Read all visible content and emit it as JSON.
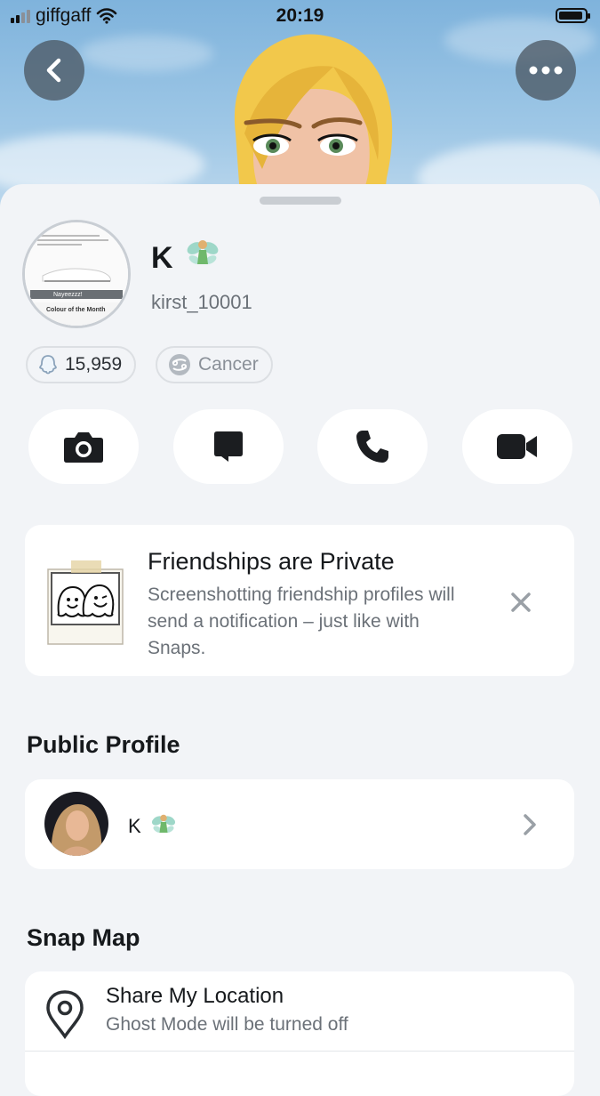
{
  "status_bar": {
    "carrier": "giffgaff",
    "time": "20:19"
  },
  "profile": {
    "display_name": "K",
    "username": "kirst_10001",
    "snap_score": "15,959",
    "zodiac": "Cancer"
  },
  "profile_thumb_lines": [
    "Nayeezzz!",
    "Colour of the Month"
  ],
  "actions": [
    "camera-icon",
    "chat-icon",
    "phone-icon",
    "video-icon"
  ],
  "friendship_card": {
    "title": "Friendships are Private",
    "body": "Screenshotting friendship profiles will send a notification – just like with Snaps."
  },
  "public_profile": {
    "heading": "Public Profile",
    "name": "K"
  },
  "snap_map": {
    "heading": "Snap Map",
    "item_title": "Share My Location",
    "item_subtitle": "Ghost Mode will be turned off"
  },
  "colors": {
    "sky": "#8fbde2",
    "sheet": "#f2f4f7",
    "card": "#ffffff",
    "text": "#16191c",
    "muted": "#6b7178"
  }
}
